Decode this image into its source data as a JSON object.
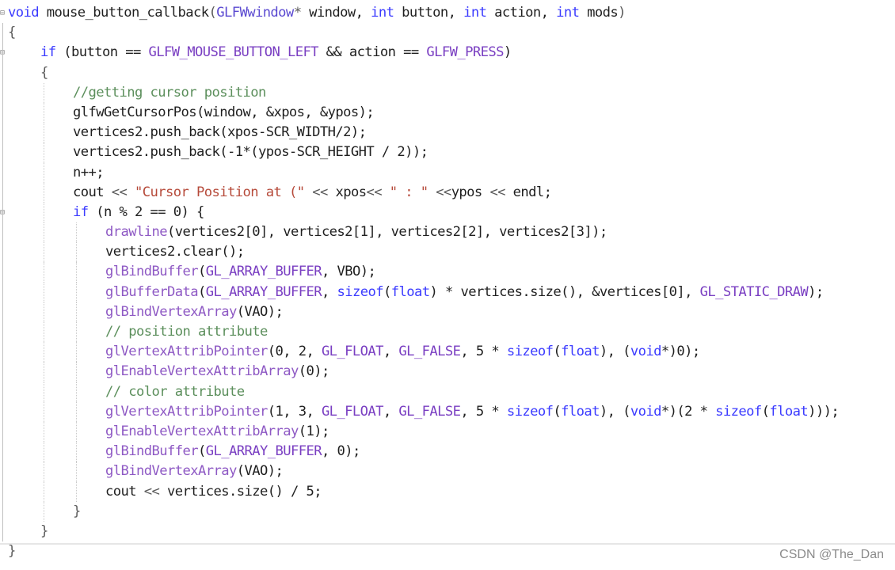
{
  "editor": {
    "lines": [
      {
        "indent": 0,
        "fold": true,
        "tokens": [
          {
            "t": "kw",
            "v": "void"
          },
          {
            "t": "txt",
            "v": " "
          },
          {
            "t": "txt",
            "v": "mouse_button_callback"
          },
          {
            "t": "op",
            "v": "("
          },
          {
            "t": "type",
            "v": "GLFWwindow"
          },
          {
            "t": "op",
            "v": "*"
          },
          {
            "t": "txt",
            "v": " window, "
          },
          {
            "t": "kw",
            "v": "int"
          },
          {
            "t": "txt",
            "v": " button, "
          },
          {
            "t": "kw",
            "v": "int"
          },
          {
            "t": "txt",
            "v": " action, "
          },
          {
            "t": "kw",
            "v": "int"
          },
          {
            "t": "txt",
            "v": " mods"
          },
          {
            "t": "op",
            "v": ")"
          }
        ]
      },
      {
        "indent": 0,
        "fold": false,
        "tokens": [
          {
            "t": "op",
            "v": "{"
          }
        ]
      },
      {
        "indent": 1,
        "fold": true,
        "tokens": [
          {
            "t": "kw",
            "v": "if"
          },
          {
            "t": "txt",
            "v": " (button == "
          },
          {
            "t": "macro",
            "v": "GLFW_MOUSE_BUTTON_LEFT"
          },
          {
            "t": "txt",
            "v": " && action == "
          },
          {
            "t": "macro",
            "v": "GLFW_PRESS"
          },
          {
            "t": "txt",
            "v": ")"
          }
        ]
      },
      {
        "indent": 1,
        "fold": false,
        "tokens": [
          {
            "t": "op",
            "v": "{"
          }
        ]
      },
      {
        "indent": 2,
        "fold": false,
        "tokens": [
          {
            "t": "comment",
            "v": "//getting cursor position"
          }
        ]
      },
      {
        "indent": 2,
        "fold": false,
        "tokens": [
          {
            "t": "txt",
            "v": "glfwGetCursorPos(window, &xpos, &ypos);"
          }
        ]
      },
      {
        "indent": 2,
        "fold": false,
        "tokens": [
          {
            "t": "txt",
            "v": "vertices2.push_back(xpos-SCR_WIDTH/2);"
          }
        ]
      },
      {
        "indent": 2,
        "fold": false,
        "tokens": [
          {
            "t": "txt",
            "v": "vertices2.push_back(-1*(ypos-SCR_HEIGHT / 2));"
          }
        ]
      },
      {
        "indent": 2,
        "fold": false,
        "tokens": [
          {
            "t": "txt",
            "v": "n++;"
          }
        ]
      },
      {
        "indent": 2,
        "fold": false,
        "tokens": [
          {
            "t": "txt",
            "v": "cout "
          },
          {
            "t": "op",
            "v": "<<"
          },
          {
            "t": "str",
            "v": " \"Cursor Position at (\" "
          },
          {
            "t": "op",
            "v": "<<"
          },
          {
            "t": "txt",
            "v": " xpos"
          },
          {
            "t": "op",
            "v": "<<"
          },
          {
            "t": "str",
            "v": " \" : \" "
          },
          {
            "t": "op",
            "v": "<<"
          },
          {
            "t": "txt",
            "v": "ypos "
          },
          {
            "t": "op",
            "v": "<<"
          },
          {
            "t": "txt",
            "v": " endl;"
          }
        ]
      },
      {
        "indent": 2,
        "fold": true,
        "tokens": [
          {
            "t": "kw",
            "v": "if"
          },
          {
            "t": "txt",
            "v": " (n % 2 == 0) {"
          }
        ]
      },
      {
        "indent": 3,
        "fold": false,
        "tokens": [
          {
            "t": "fn",
            "v": "drawline"
          },
          {
            "t": "txt",
            "v": "(vertices2[0], vertices2[1], vertices2[2], vertices2[3]);"
          }
        ]
      },
      {
        "indent": 3,
        "fold": false,
        "tokens": [
          {
            "t": "txt",
            "v": "vertices2.clear();"
          }
        ]
      },
      {
        "indent": 3,
        "fold": false,
        "tokens": [
          {
            "t": "fn",
            "v": "glBindBuffer"
          },
          {
            "t": "txt",
            "v": "("
          },
          {
            "t": "macro",
            "v": "GL_ARRAY_BUFFER"
          },
          {
            "t": "txt",
            "v": ", VBO);"
          }
        ]
      },
      {
        "indent": 3,
        "fold": false,
        "tokens": [
          {
            "t": "fn",
            "v": "glBufferData"
          },
          {
            "t": "txt",
            "v": "("
          },
          {
            "t": "macro",
            "v": "GL_ARRAY_BUFFER"
          },
          {
            "t": "txt",
            "v": ", "
          },
          {
            "t": "kw",
            "v": "sizeof"
          },
          {
            "t": "txt",
            "v": "("
          },
          {
            "t": "kw",
            "v": "float"
          },
          {
            "t": "txt",
            "v": ") * vertices.size(), &vertices[0], "
          },
          {
            "t": "macro",
            "v": "GL_STATIC_DRAW"
          },
          {
            "t": "txt",
            "v": ");"
          }
        ]
      },
      {
        "indent": 3,
        "fold": false,
        "tokens": [
          {
            "t": "fn",
            "v": "glBindVertexArray"
          },
          {
            "t": "txt",
            "v": "(VAO);"
          }
        ]
      },
      {
        "indent": 3,
        "fold": false,
        "tokens": [
          {
            "t": "comment",
            "v": "// position attribute"
          }
        ]
      },
      {
        "indent": 3,
        "fold": false,
        "tokens": [
          {
            "t": "fn",
            "v": "glVertexAttribPointer"
          },
          {
            "t": "txt",
            "v": "(0, 2, "
          },
          {
            "t": "macro",
            "v": "GL_FLOAT"
          },
          {
            "t": "txt",
            "v": ", "
          },
          {
            "t": "macro",
            "v": "GL_FALSE"
          },
          {
            "t": "txt",
            "v": ", 5 * "
          },
          {
            "t": "kw",
            "v": "sizeof"
          },
          {
            "t": "txt",
            "v": "("
          },
          {
            "t": "kw",
            "v": "float"
          },
          {
            "t": "txt",
            "v": "), ("
          },
          {
            "t": "kw",
            "v": "void"
          },
          {
            "t": "txt",
            "v": "*)0);"
          }
        ]
      },
      {
        "indent": 3,
        "fold": false,
        "tokens": [
          {
            "t": "fn",
            "v": "glEnableVertexAttribArray"
          },
          {
            "t": "txt",
            "v": "(0);"
          }
        ]
      },
      {
        "indent": 3,
        "fold": false,
        "tokens": [
          {
            "t": "comment",
            "v": "// color attribute"
          }
        ]
      },
      {
        "indent": 3,
        "fold": false,
        "tokens": [
          {
            "t": "fn",
            "v": "glVertexAttribPointer"
          },
          {
            "t": "txt",
            "v": "(1, 3, "
          },
          {
            "t": "macro",
            "v": "GL_FLOAT"
          },
          {
            "t": "txt",
            "v": ", "
          },
          {
            "t": "macro",
            "v": "GL_FALSE"
          },
          {
            "t": "txt",
            "v": ", 5 * "
          },
          {
            "t": "kw",
            "v": "sizeof"
          },
          {
            "t": "txt",
            "v": "("
          },
          {
            "t": "kw",
            "v": "float"
          },
          {
            "t": "txt",
            "v": "), ("
          },
          {
            "t": "kw",
            "v": "void"
          },
          {
            "t": "txt",
            "v": "*)(2 * "
          },
          {
            "t": "kw",
            "v": "sizeof"
          },
          {
            "t": "txt",
            "v": "("
          },
          {
            "t": "kw",
            "v": "float"
          },
          {
            "t": "txt",
            "v": ")));"
          }
        ]
      },
      {
        "indent": 3,
        "fold": false,
        "tokens": [
          {
            "t": "fn",
            "v": "glEnableVertexAttribArray"
          },
          {
            "t": "txt",
            "v": "(1);"
          }
        ]
      },
      {
        "indent": 3,
        "fold": false,
        "tokens": [
          {
            "t": "fn",
            "v": "glBindBuffer"
          },
          {
            "t": "txt",
            "v": "("
          },
          {
            "t": "macro",
            "v": "GL_ARRAY_BUFFER"
          },
          {
            "t": "txt",
            "v": ", 0);"
          }
        ]
      },
      {
        "indent": 3,
        "fold": false,
        "tokens": [
          {
            "t": "fn",
            "v": "glBindVertexArray"
          },
          {
            "t": "txt",
            "v": "(VAO);"
          }
        ]
      },
      {
        "indent": 3,
        "fold": false,
        "tokens": [
          {
            "t": "txt",
            "v": "cout "
          },
          {
            "t": "op",
            "v": "<<"
          },
          {
            "t": "txt",
            "v": " vertices.size() / 5;"
          }
        ]
      },
      {
        "indent": 2,
        "fold": false,
        "tokens": [
          {
            "t": "op",
            "v": "}"
          }
        ]
      },
      {
        "indent": 1,
        "fold": false,
        "tokens": [
          {
            "t": "op",
            "v": "}"
          }
        ]
      },
      {
        "indent": 0,
        "fold": false,
        "tokens": [
          {
            "t": "op",
            "v": "}"
          }
        ]
      }
    ]
  },
  "watermark": "CSDN @The_Dan",
  "colors": {
    "keyword": "#3b3bff",
    "function": "#8e59c4",
    "macro": "#7a3fc2",
    "string": "#b64a3a",
    "comment": "#5c8f5c",
    "text": "#1f1f1f"
  }
}
